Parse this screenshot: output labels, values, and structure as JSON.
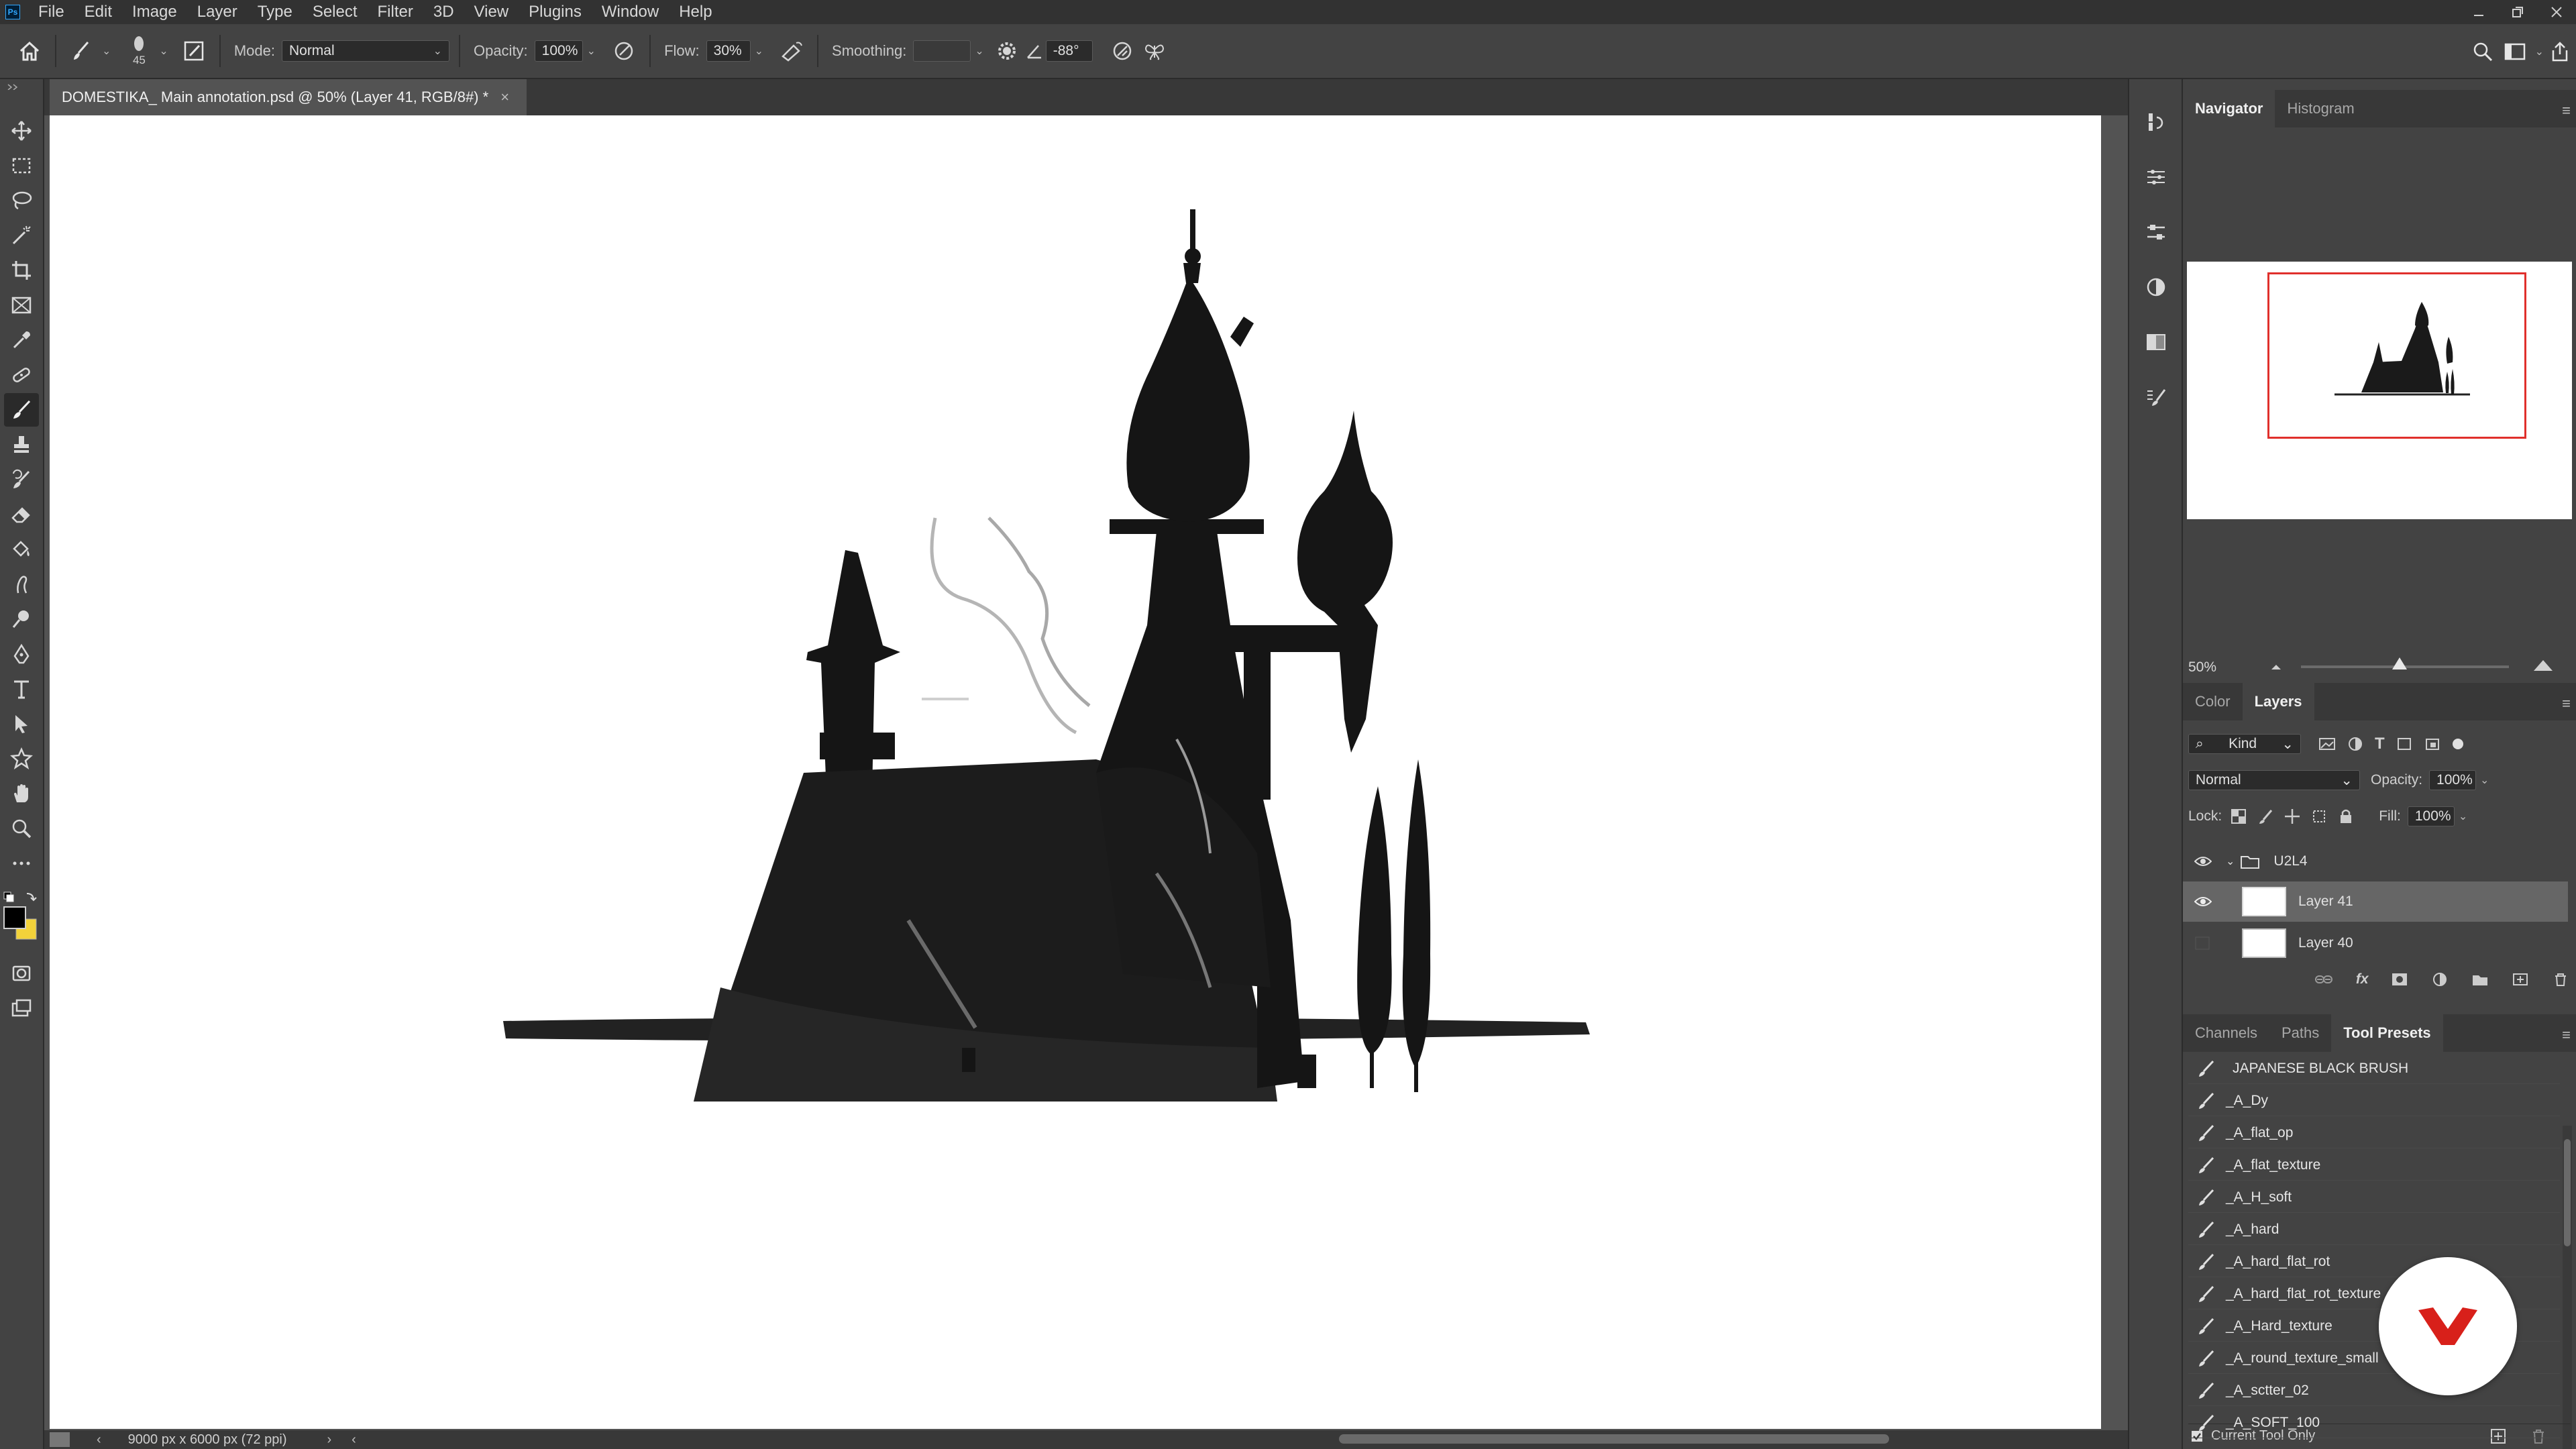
{
  "menubar": {
    "app_icon": "Ps",
    "items": [
      "File",
      "Edit",
      "Image",
      "Layer",
      "Type",
      "Select",
      "Filter",
      "3D",
      "View",
      "Plugins",
      "Window",
      "Help"
    ]
  },
  "options": {
    "brush_size": "45",
    "mode_label": "Mode:",
    "mode_value": "Normal",
    "opacity_label": "Opacity:",
    "opacity_value": "100%",
    "flow_label": "Flow:",
    "flow_value": "30%",
    "smoothing_label": "Smoothing:",
    "smoothing_value": "",
    "angle_value": "-88°"
  },
  "document": {
    "tab_title": "DOMESTIKA_ Main annotation.psd @ 50% (Layer 41, RGB/8#) *",
    "status": "9000 px x 6000 px (72 ppi)"
  },
  "navigator": {
    "tabs": [
      "Navigator",
      "Histogram"
    ],
    "zoom": "50%"
  },
  "layers_panel": {
    "tabs": [
      "Color",
      "Layers"
    ],
    "filter_label": "Kind",
    "blend_mode": "Normal",
    "opacity_label": "Opacity:",
    "opacity_value": "100%",
    "lock_label": "Lock:",
    "fill_label": "Fill:",
    "fill_value": "100%",
    "group_name": "U2L4",
    "layers": [
      {
        "name": "Layer 41",
        "visible": true,
        "selected": true
      },
      {
        "name": "Layer 40",
        "visible": false,
        "selected": false
      }
    ]
  },
  "presets_panel": {
    "tabs": [
      "Channels",
      "Paths",
      "Tool Presets"
    ],
    "items": [
      "JAPANESE BLACK BRUSH",
      "_A_Dy",
      "_A_flat_op",
      "_A_flat_texture",
      "_A_H_soft",
      "_A_hard",
      "_A_hard_flat_rot",
      "_A_hard_flat_rot_texture",
      "_A_Hard_texture",
      "_A_round_texture_small",
      "_A_sctter_02",
      "_A_SOFT_100"
    ],
    "current_tool_only": "Current Tool Only"
  },
  "colors": {
    "accent_navigator_frame": "#e0302c",
    "badge_mark": "#d8201a",
    "background_swatch": "#f2d23a",
    "foreground_swatch": "#000000"
  }
}
